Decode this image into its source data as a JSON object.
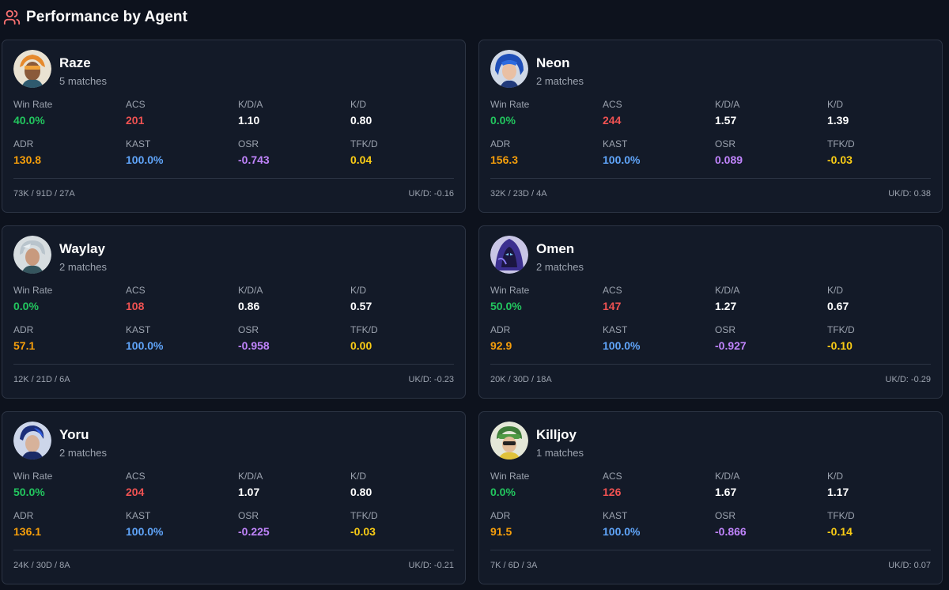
{
  "header": {
    "title": "Performance by Agent",
    "icon": "users-icon"
  },
  "colors": {
    "win_rate": "#22c55e",
    "acs": "#f05252",
    "kda": "#ffffff",
    "kd": "#ffffff",
    "adr": "#f59e0b",
    "kast": "#60a5fa",
    "osr": "#c084fc",
    "tfkd": "#facc15",
    "header_icon": "#f87171"
  },
  "labels": {
    "win_rate": "Win Rate",
    "acs": "ACS",
    "kda": "K/D/A",
    "kd": "K/D",
    "adr": "ADR",
    "kast": "KAST",
    "osr": "OSR",
    "tfkd": "TFK/D"
  },
  "agents": [
    {
      "name": "Raze",
      "matches": "5 matches",
      "win_rate": "40.0%",
      "acs": "201",
      "kda": "1.10",
      "kd": "0.80",
      "adr": "130.8",
      "kast": "100.0%",
      "osr": "-0.743",
      "tfkd": "0.04",
      "totals": "73K / 91D / 27A",
      "ukd": "UK/D: -0.16",
      "avatar": "raze-portrait"
    },
    {
      "name": "Neon",
      "matches": "2 matches",
      "win_rate": "0.0%",
      "acs": "244",
      "kda": "1.57",
      "kd": "1.39",
      "adr": "156.3",
      "kast": "100.0%",
      "osr": "0.089",
      "tfkd": "-0.03",
      "totals": "32K / 23D / 4A",
      "ukd": "UK/D: 0.38",
      "avatar": "neon-portrait"
    },
    {
      "name": "Waylay",
      "matches": "2 matches",
      "win_rate": "0.0%",
      "acs": "108",
      "kda": "0.86",
      "kd": "0.57",
      "adr": "57.1",
      "kast": "100.0%",
      "osr": "-0.958",
      "tfkd": "0.00",
      "totals": "12K / 21D / 6A",
      "ukd": "UK/D: -0.23",
      "avatar": "waylay-portrait"
    },
    {
      "name": "Omen",
      "matches": "2 matches",
      "win_rate": "50.0%",
      "acs": "147",
      "kda": "1.27",
      "kd": "0.67",
      "adr": "92.9",
      "kast": "100.0%",
      "osr": "-0.927",
      "tfkd": "-0.10",
      "totals": "20K / 30D / 18A",
      "ukd": "UK/D: -0.29",
      "avatar": "omen-portrait"
    },
    {
      "name": "Yoru",
      "matches": "2 matches",
      "win_rate": "50.0%",
      "acs": "204",
      "kda": "1.07",
      "kd": "0.80",
      "adr": "136.1",
      "kast": "100.0%",
      "osr": "-0.225",
      "tfkd": "-0.03",
      "totals": "24K / 30D / 8A",
      "ukd": "UK/D: -0.21",
      "avatar": "yoru-portrait"
    },
    {
      "name": "Killjoy",
      "matches": "1 matches",
      "win_rate": "0.0%",
      "acs": "126",
      "kda": "1.67",
      "kd": "1.17",
      "adr": "91.5",
      "kast": "100.0%",
      "osr": "-0.866",
      "tfkd": "-0.14",
      "totals": "7K / 6D / 3A",
      "ukd": "UK/D: 0.07",
      "avatar": "killjoy-portrait"
    }
  ]
}
